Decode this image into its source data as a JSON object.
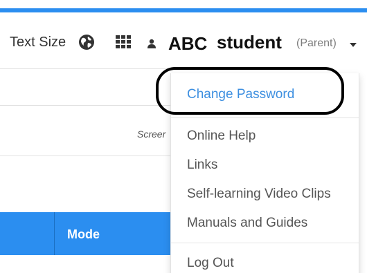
{
  "header": {
    "text_size_label": "Text Size",
    "globe_icon": "globe-icon",
    "apps_icon": "grid-icon",
    "user_icon": "user-icon",
    "org_name": "ABC",
    "user_name": "student",
    "role": "(Parent)",
    "caret_icon": "caret-down-icon"
  },
  "main": {
    "screen_text": "Screer",
    "table_header": {
      "columns": [
        "",
        "Mode"
      ]
    }
  },
  "dropdown": {
    "items": [
      {
        "label": "Change Password"
      },
      {
        "label": "Online Help"
      },
      {
        "label": "Links"
      },
      {
        "label": "Self-learning Video Clips"
      },
      {
        "label": "Manuals and Guides"
      },
      {
        "label": "Log Out"
      }
    ]
  },
  "colors": {
    "accent": "#2b8ef0",
    "link_highlight": "#3d8fe0",
    "annotation": "#000000"
  }
}
